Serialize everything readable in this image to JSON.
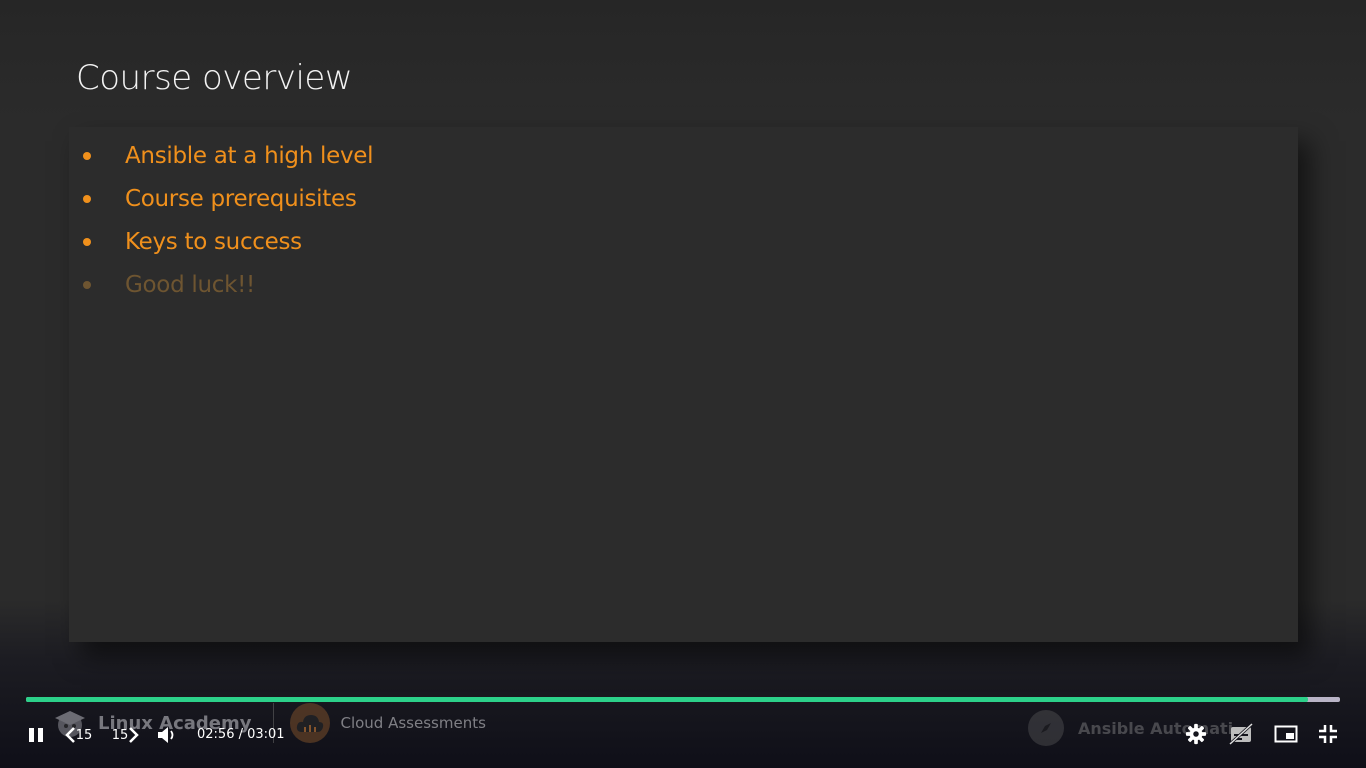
{
  "slide": {
    "title": "Course overview",
    "bullets": [
      {
        "text": "Ansible at a high level"
      },
      {
        "text": "Course prerequisites"
      },
      {
        "text": "Keys to success"
      },
      {
        "text": "Good luck!!"
      }
    ]
  },
  "watermark": {
    "left_brand": "Linux Academy",
    "left_product": "Cloud Assessments",
    "right_text": "Ansible Automati"
  },
  "player": {
    "progress_fraction": 0.976,
    "rewind_seconds": "15",
    "forward_seconds": "15",
    "time_display": "02:56 / 03:01",
    "icons": [
      "pause-icon",
      "rewind-15-icon",
      "forward-15-icon",
      "volume-icon",
      "settings-icon",
      "captions-off-icon",
      "picture-in-picture-icon",
      "exit-fullscreen-icon"
    ]
  },
  "colors": {
    "accent_orange": "#f0901c",
    "dim_orange": "#6e5531",
    "progress_green": "#2cd08a",
    "progress_track": "#b9b4c7"
  }
}
